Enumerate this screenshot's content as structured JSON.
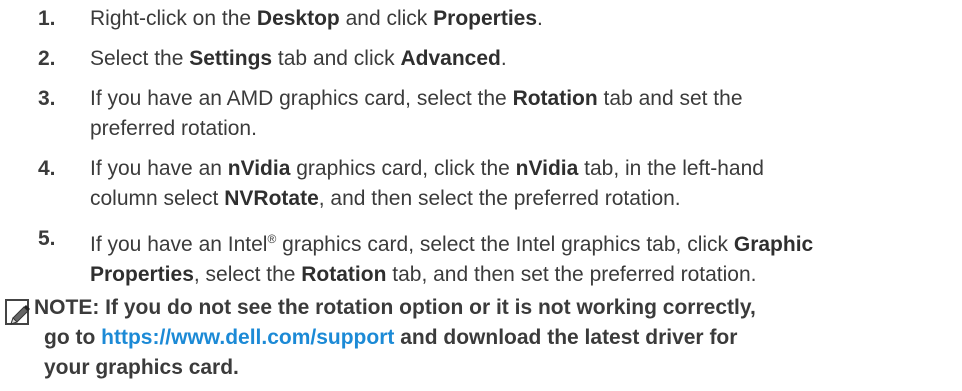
{
  "steps": [
    {
      "number": "1.",
      "parts": [
        "Right-click on the ",
        "Desktop",
        " and click ",
        "Properties",
        "."
      ]
    },
    {
      "number": "2.",
      "parts": [
        "Select the ",
        "Settings",
        " tab and click ",
        "Advanced",
        "."
      ]
    },
    {
      "number": "3.",
      "line1": [
        "If you have an AMD graphics card, select the ",
        "Rotation",
        " tab and set the"
      ],
      "line2": "preferred rotation."
    },
    {
      "number": "4.",
      "line1": [
        "If you have an ",
        "nVidia",
        " graphics card, click the ",
        "nVidia",
        " tab, in the left-hand"
      ],
      "line2": [
        "column select ",
        "NVRotate",
        ", and then select the preferred rotation."
      ]
    },
    {
      "number": "5.",
      "line1": [
        "If you have an Intel",
        "®",
        " graphics card, select the Intel graphics tab, click ",
        "Graphic"
      ],
      "line2": [
        "Properties",
        ", select the ",
        "Rotation",
        " tab, and then set the preferred rotation."
      ]
    }
  ],
  "note": {
    "icon": "pencil-icon",
    "line1": "NOTE: If you do not see the rotation option or it is not working correctly,",
    "line2_before": "go to ",
    "link": "https://www.dell.com/support",
    "line2_after": " and download the latest driver for",
    "line3": "your graphics card."
  },
  "colors": {
    "text": "#3b3b3b",
    "link": "#1c8ad6"
  }
}
